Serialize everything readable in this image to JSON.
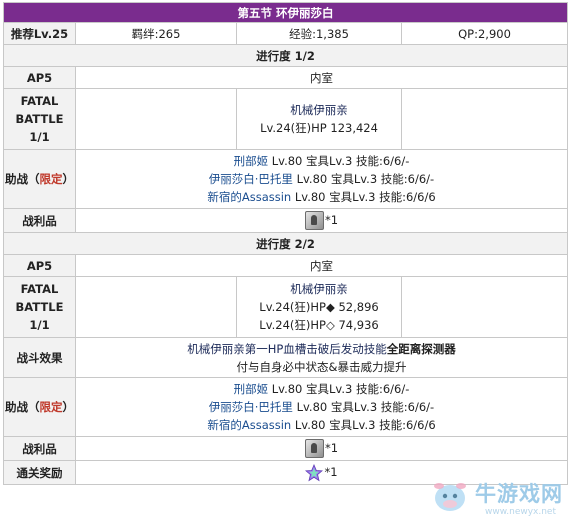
{
  "title": "第五节 环伊丽莎白",
  "summary": {
    "recommend_label": "推荐Lv.25",
    "bond": "羁绊:265",
    "exp": "经验:1,385",
    "qp": "QP:2,900"
  },
  "colors": {
    "title_bg": "#7a2c8e",
    "label_bg": "#f2f2f2",
    "border": "#c8c8c8",
    "link": "#1a4d8f",
    "limited": "#c0392b"
  },
  "progress1": {
    "header": "进行度 1/2",
    "ap_label": "AP5",
    "location": "内室",
    "battle_label": [
      "FATAL",
      "BATTLE",
      "1/1"
    ],
    "enemy_name": "机械伊丽亲",
    "enemy_stats": "Lv.24(狂)HP 123,424",
    "support_label": {
      "prefix": "助战（",
      "limited": "限定",
      "suffix": "）"
    },
    "supports": [
      {
        "name": "刑部姬",
        "detail": " Lv.80 宝具Lv.3 技能:6/6/-"
      },
      {
        "name": "伊丽莎白·巴托里",
        "detail": " Lv.80 宝具Lv.3 技能:6/6/-"
      },
      {
        "name": "新宿的Assassin",
        "detail": " Lv.80 宝具Lv.3 技能:6/6/6"
      }
    ],
    "loot_label": "战利品",
    "loot_icon": "statue-icon",
    "loot_count": "*1"
  },
  "progress2": {
    "header": "进行度 2/2",
    "ap_label": "AP5",
    "location": "内室",
    "battle_label": [
      "FATAL",
      "BATTLE",
      "1/1"
    ],
    "enemy_name": "机械伊丽亲",
    "enemy_stats": [
      "Lv.24(狂)HP◆ 52,896",
      "Lv.24(狂)HP◇ 74,936"
    ],
    "effect_label": "战斗效果",
    "effect_line1_a": "机械伊丽亲第一HP血槽击破后发动技能",
    "effect_line1_b": "全距离探测器",
    "effect_line2": "付与自身必中状态&暴击威力提升",
    "support_label": {
      "prefix": "助战（",
      "limited": "限定",
      "suffix": "）"
    },
    "supports": [
      {
        "name": "刑部姬",
        "detail": " Lv.80 宝具Lv.3 技能:6/6/-"
      },
      {
        "name": "伊丽莎白·巴托里",
        "detail": " Lv.80 宝具Lv.3 技能:6/6/-"
      },
      {
        "name": "新宿的Assassin",
        "detail": " Lv.80 宝具Lv.3 技能:6/6/6"
      }
    ],
    "loot_label": "战利品",
    "loot_icon": "statue-icon",
    "loot_count": "*1",
    "reward_label": "通关奖励",
    "reward_icon": "saint-quartz-icon",
    "reward_count": "*1"
  },
  "watermark": {
    "text": "牛游戏网",
    "url": "www.newyx.net",
    "icon": "cow-logo-icon"
  }
}
